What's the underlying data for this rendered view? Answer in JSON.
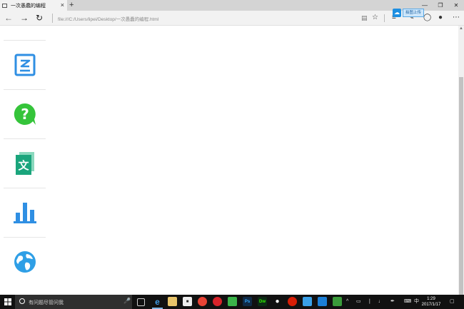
{
  "browser": {
    "tab_title": "一次愚蠢的编程",
    "tab_close": "×",
    "new_tab": "+",
    "url": "file:///C:/Users/lipei/Desktop/一次愚蠢的编程.html",
    "window_controls": [
      "—",
      "❐",
      "✕"
    ],
    "float_button_label": "拍图上传"
  },
  "sidebar": {
    "items": [
      {
        "icon": "image-icon",
        "color": "#2f8fe3"
      },
      {
        "icon": "question-icon",
        "color": "#35c43a"
      },
      {
        "icon": "translate-icon",
        "color": "#1aa57c"
      },
      {
        "icon": "bar-chart-icon",
        "color": "#2f8fe3"
      },
      {
        "icon": "globe-icon",
        "color": "#2f9fe6"
      }
    ]
  },
  "taskbar": {
    "search_placeholder": "有问题尽管问我",
    "tray_lang": "中",
    "time": "1:29",
    "date": "2017/1/17"
  }
}
